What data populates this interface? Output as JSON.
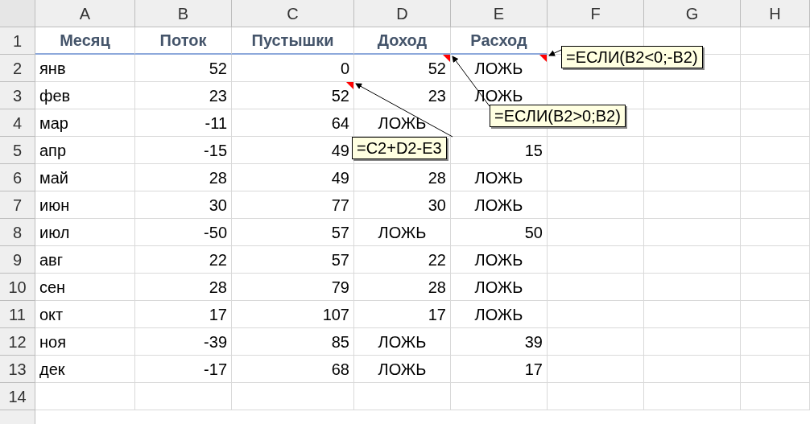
{
  "columns": [
    "A",
    "B",
    "C",
    "D",
    "E",
    "F",
    "G",
    "H"
  ],
  "rows": [
    {
      "number": "1",
      "cells": [
        {
          "text": "Месяц",
          "kind": "title"
        },
        {
          "text": "Поток",
          "kind": "title"
        },
        {
          "text": "Пустышки",
          "kind": "title"
        },
        {
          "text": "Доход",
          "kind": "title"
        },
        {
          "text": "Расход",
          "kind": "title"
        }
      ]
    },
    {
      "number": "2",
      "cells": [
        {
          "text": "янв",
          "kind": "text"
        },
        {
          "text": "52",
          "kind": "number"
        },
        {
          "text": "0",
          "kind": "number"
        },
        {
          "text": "52",
          "kind": "number",
          "comment": "=ЕСЛИ(B2>0;B2)"
        },
        {
          "text": "ЛОЖЬ",
          "kind": "boolean",
          "comment": "=ЕСЛИ(B2<0;-B2)"
        }
      ]
    },
    {
      "number": "3",
      "cells": [
        {
          "text": "фев",
          "kind": "text"
        },
        {
          "text": "23",
          "kind": "number"
        },
        {
          "text": "52",
          "kind": "number",
          "comment": "=C2+D2-E3"
        },
        {
          "text": "23",
          "kind": "number"
        },
        {
          "text": "ЛОЖЬ",
          "kind": "boolean"
        }
      ]
    },
    {
      "number": "4",
      "cells": [
        {
          "text": "мар",
          "kind": "text"
        },
        {
          "text": "-11",
          "kind": "number"
        },
        {
          "text": "64",
          "kind": "number"
        },
        {
          "text": "ЛОЖЬ",
          "kind": "boolean"
        },
        null
      ]
    },
    {
      "number": "5",
      "cells": [
        {
          "text": "апр",
          "kind": "text"
        },
        {
          "text": "-15",
          "kind": "number"
        },
        {
          "text": "49",
          "kind": "number"
        },
        null,
        {
          "text": "15",
          "kind": "number"
        }
      ]
    },
    {
      "number": "6",
      "cells": [
        {
          "text": "май",
          "kind": "text"
        },
        {
          "text": "28",
          "kind": "number"
        },
        {
          "text": "49",
          "kind": "number"
        },
        {
          "text": "28",
          "kind": "number"
        },
        {
          "text": "ЛОЖЬ",
          "kind": "boolean"
        }
      ]
    },
    {
      "number": "7",
      "cells": [
        {
          "text": "июн",
          "kind": "text"
        },
        {
          "text": "30",
          "kind": "number"
        },
        {
          "text": "77",
          "kind": "number"
        },
        {
          "text": "30",
          "kind": "number"
        },
        {
          "text": "ЛОЖЬ",
          "kind": "boolean"
        }
      ]
    },
    {
      "number": "8",
      "cells": [
        {
          "text": "июл",
          "kind": "text"
        },
        {
          "text": "-50",
          "kind": "number"
        },
        {
          "text": "57",
          "kind": "number"
        },
        {
          "text": "ЛОЖЬ",
          "kind": "boolean"
        },
        {
          "text": "50",
          "kind": "number"
        }
      ]
    },
    {
      "number": "9",
      "cells": [
        {
          "text": "авг",
          "kind": "text"
        },
        {
          "text": "22",
          "kind": "number"
        },
        {
          "text": "57",
          "kind": "number"
        },
        {
          "text": "22",
          "kind": "number"
        },
        {
          "text": "ЛОЖЬ",
          "kind": "boolean"
        }
      ]
    },
    {
      "number": "10",
      "cells": [
        {
          "text": "сен",
          "kind": "text"
        },
        {
          "text": "28",
          "kind": "number"
        },
        {
          "text": "79",
          "kind": "number"
        },
        {
          "text": "28",
          "kind": "number"
        },
        {
          "text": "ЛОЖЬ",
          "kind": "boolean"
        }
      ]
    },
    {
      "number": "11",
      "cells": [
        {
          "text": "окт",
          "kind": "text"
        },
        {
          "text": "17",
          "kind": "number"
        },
        {
          "text": "107",
          "kind": "number"
        },
        {
          "text": "17",
          "kind": "number"
        },
        {
          "text": "ЛОЖЬ",
          "kind": "boolean"
        }
      ]
    },
    {
      "number": "12",
      "cells": [
        {
          "text": "ноя",
          "kind": "text"
        },
        {
          "text": "-39",
          "kind": "number"
        },
        {
          "text": "85",
          "kind": "number"
        },
        {
          "text": "ЛОЖЬ",
          "kind": "boolean"
        },
        {
          "text": "39",
          "kind": "number"
        }
      ]
    },
    {
      "number": "13",
      "cells": [
        {
          "text": "дек",
          "kind": "text"
        },
        {
          "text": "-17",
          "kind": "number"
        },
        {
          "text": "68",
          "kind": "number"
        },
        {
          "text": "ЛОЖЬ",
          "kind": "boolean"
        },
        {
          "text": "17",
          "kind": "number"
        }
      ]
    },
    {
      "number": "14",
      "cells": []
    }
  ]
}
